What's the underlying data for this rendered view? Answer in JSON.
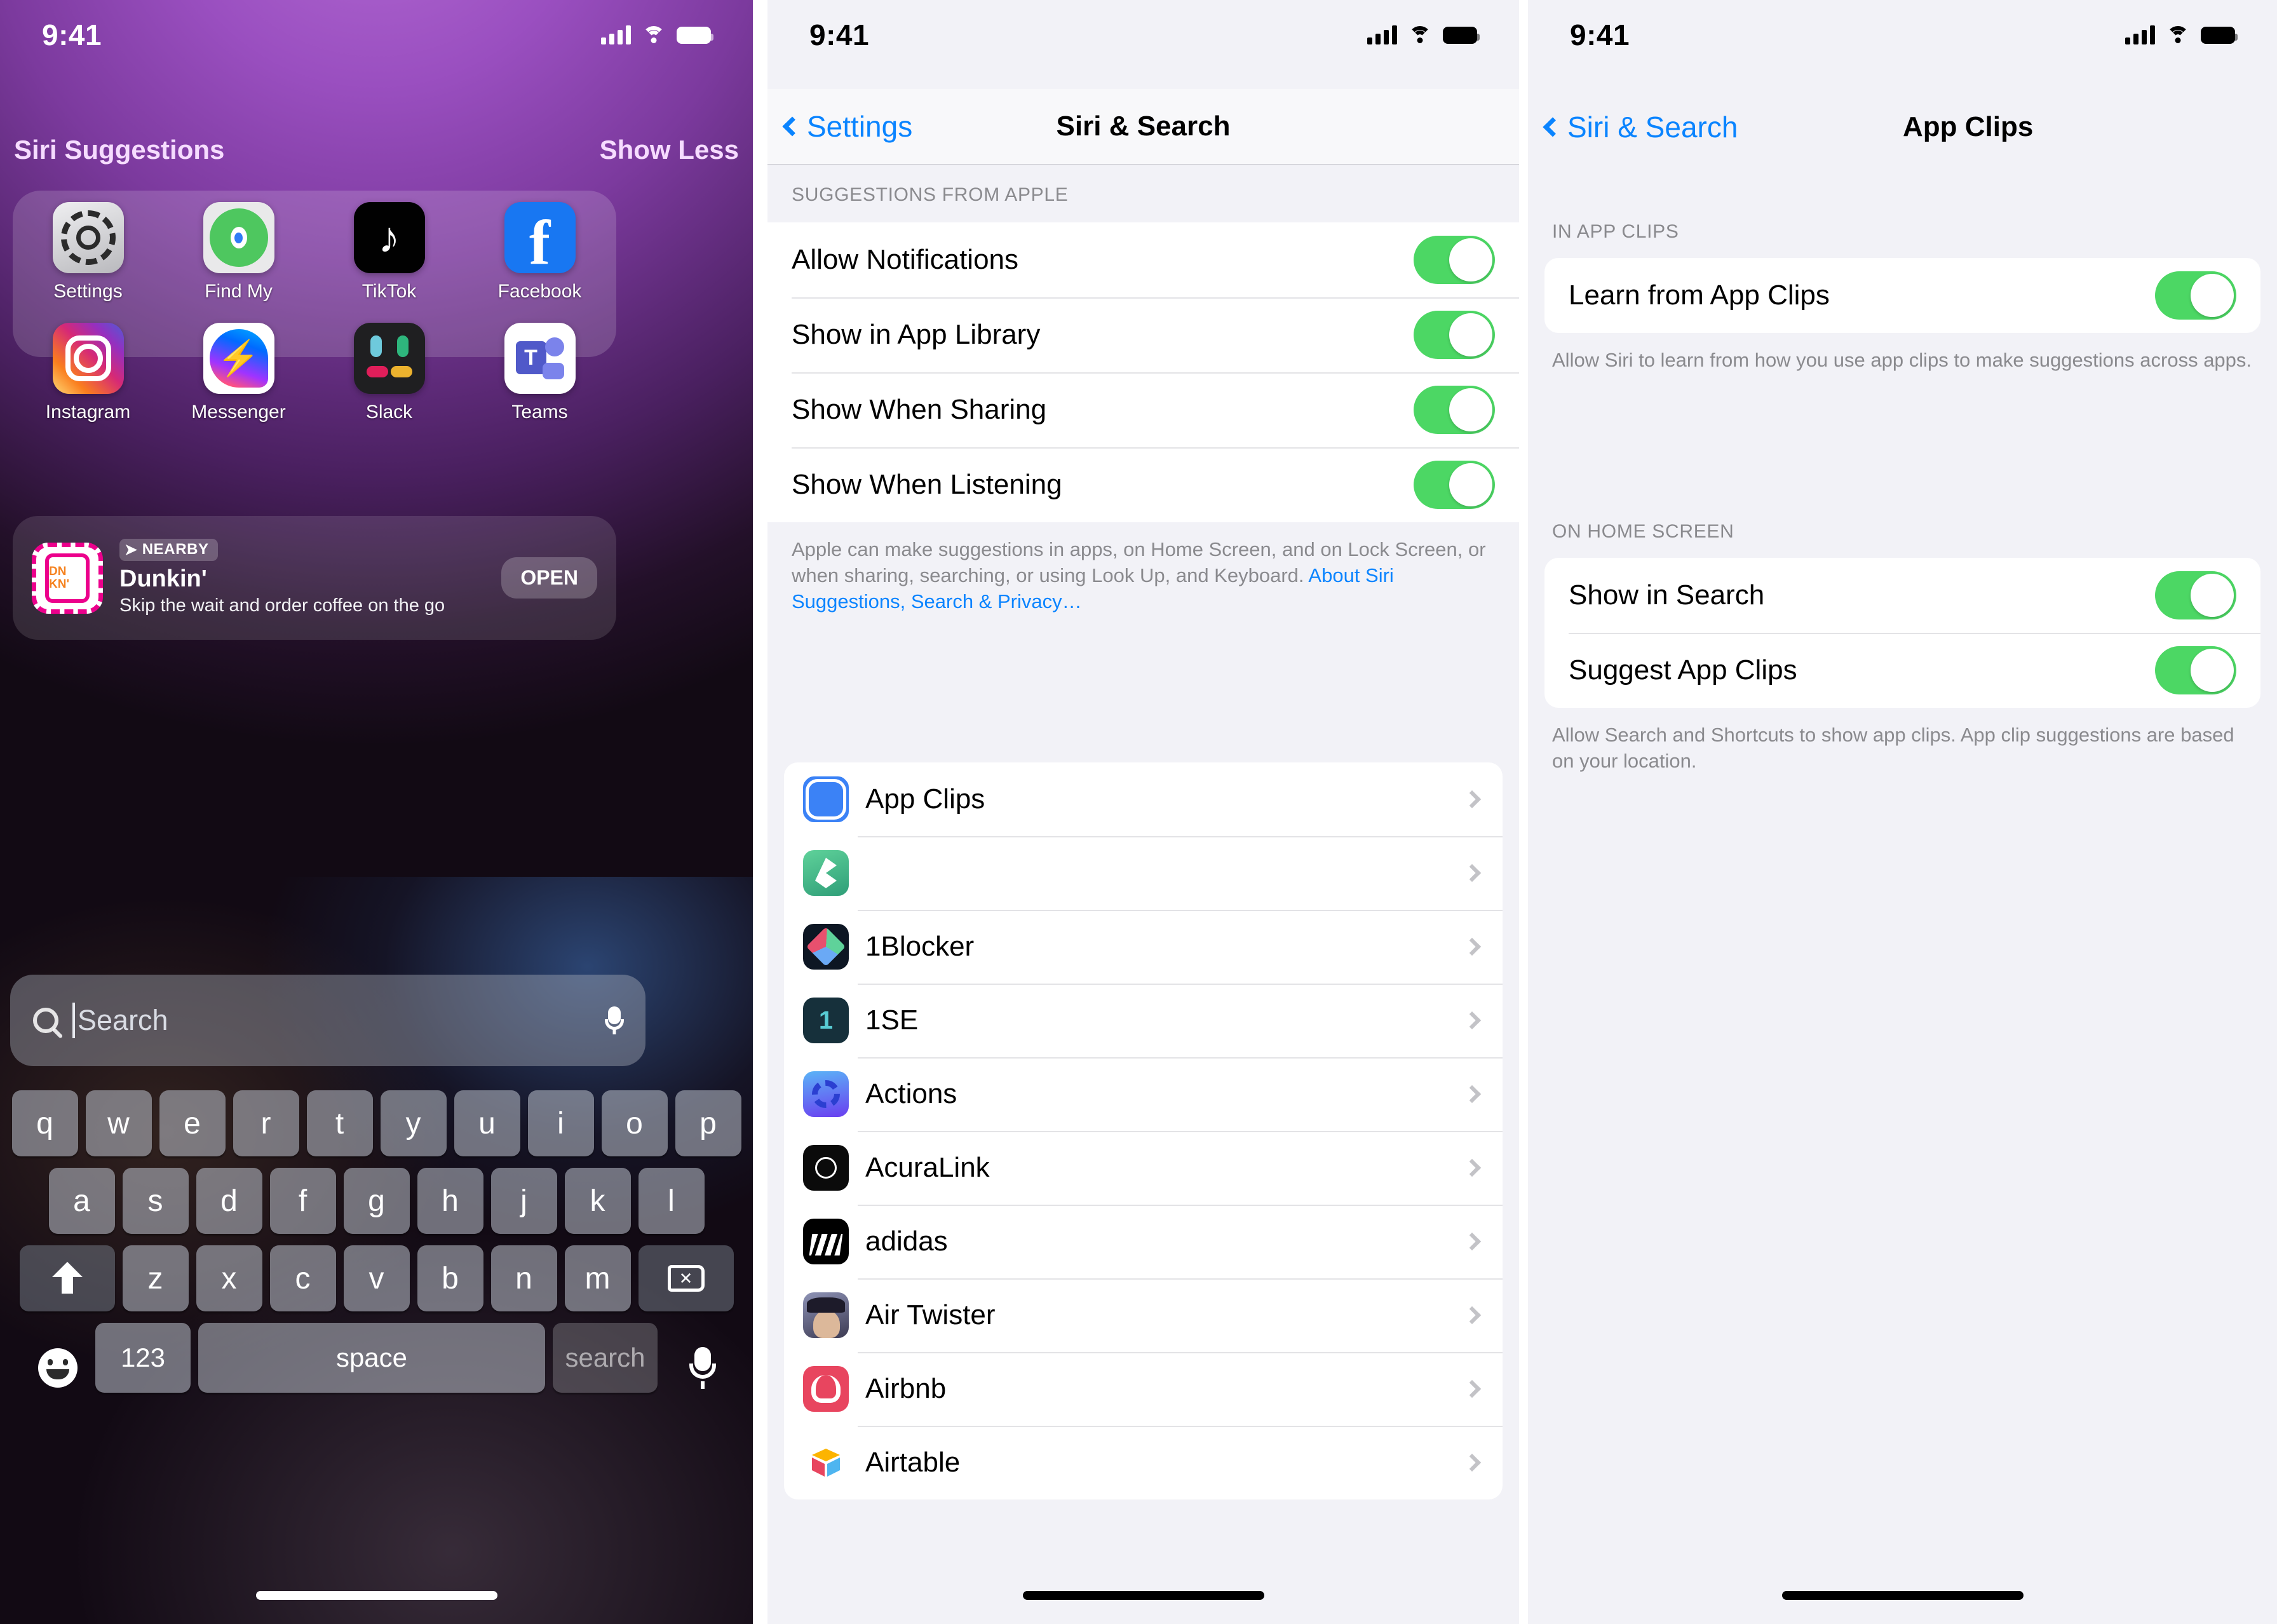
{
  "panel1": {
    "status_bar": {
      "time": "9:41",
      "cellular_icon": "cellular-bars-icon",
      "wifi_icon": "wifi-icon",
      "battery_icon": "battery-icon"
    },
    "header": {
      "title": "Siri Suggestions",
      "action": "Show Less"
    },
    "apps": [
      {
        "label": "Settings",
        "icon": "settings-app-icon"
      },
      {
        "label": "Find My",
        "icon": "find-my-app-icon"
      },
      {
        "label": "TikTok",
        "icon": "tiktok-app-icon"
      },
      {
        "label": "Facebook",
        "icon": "facebook-app-icon"
      },
      {
        "label": "Instagram",
        "icon": "instagram-app-icon"
      },
      {
        "label": "Messenger",
        "icon": "messenger-app-icon"
      },
      {
        "label": "Slack",
        "icon": "slack-app-icon"
      },
      {
        "label": "Teams",
        "icon": "teams-app-icon"
      }
    ],
    "nearby_card": {
      "badge": "NEARBY",
      "badge_icon": "location-arrow-icon",
      "title": "Dunkin'",
      "subtitle": "Skip the wait and order coffee on the go",
      "button": "OPEN",
      "app_icon_text": "DN KN'"
    },
    "search": {
      "placeholder": "Search",
      "value": "",
      "search_icon": "search-icon",
      "mic_icon": "microphone-icon"
    },
    "keyboard": {
      "row1": [
        "q",
        "w",
        "e",
        "r",
        "t",
        "y",
        "u",
        "i",
        "o",
        "p"
      ],
      "row2": [
        "a",
        "s",
        "d",
        "f",
        "g",
        "h",
        "j",
        "k",
        "l"
      ],
      "row3": [
        "z",
        "x",
        "c",
        "v",
        "b",
        "n",
        "m"
      ],
      "shift_icon": "shift-key-icon",
      "delete_icon": "delete-key-icon",
      "numbers_key": "123",
      "space_key": "space",
      "return_key": "search",
      "emoji_icon": "emoji-key-icon",
      "dictation_icon": "dictation-microphone-icon"
    }
  },
  "panel2": {
    "status_bar": {
      "time": "9:41"
    },
    "nav": {
      "back_label": "Settings",
      "title": "Siri & Search",
      "back_icon": "chevron-left-icon"
    },
    "section_header": "SUGGESTIONS FROM APPLE",
    "toggles": [
      {
        "label": "Allow Notifications",
        "on": true
      },
      {
        "label": "Show in App Library",
        "on": true
      },
      {
        "label": "Show When Sharing",
        "on": true
      },
      {
        "label": "Show When Listening",
        "on": true
      }
    ],
    "footnote_text": "Apple can make suggestions in apps, on Home Screen, and on Lock Screen, or when sharing, searching, or using Look Up, and Keyboard. ",
    "footnote_link": "About Siri Suggestions, Search & Privacy…",
    "apps": [
      {
        "name": "App Clips",
        "icon": "app-clips-icon"
      },
      {
        "name": "",
        "icon": "green-diamond-app-icon"
      },
      {
        "name": "1Blocker",
        "icon": "1blocker-app-icon"
      },
      {
        "name": "1SE",
        "icon": "1se-app-icon"
      },
      {
        "name": "Actions",
        "icon": "actions-app-icon"
      },
      {
        "name": "AcuraLink",
        "icon": "acuralink-app-icon"
      },
      {
        "name": "adidas",
        "icon": "adidas-app-icon"
      },
      {
        "name": "Air Twister",
        "icon": "air-twister-app-icon"
      },
      {
        "name": "Airbnb",
        "icon": "airbnb-app-icon"
      },
      {
        "name": "Airtable",
        "icon": "airtable-app-icon"
      }
    ]
  },
  "panel3": {
    "status_bar": {
      "time": "9:41"
    },
    "nav": {
      "back_label": "Siri & Search",
      "title": "App Clips",
      "back_icon": "chevron-left-icon"
    },
    "section1_header": "IN APP CLIPS",
    "section1_toggles": [
      {
        "label": "Learn from App Clips",
        "on": true
      }
    ],
    "section1_footnote": "Allow Siri to learn from how you use app clips to make suggestions across apps.",
    "section2_header": "ON HOME SCREEN",
    "section2_toggles": [
      {
        "label": "Show in Search",
        "on": true
      },
      {
        "label": "Suggest App Clips",
        "on": true
      }
    ],
    "section2_footnote": "Allow Search and Shortcuts to show app clips. App clip suggestions are based on your location."
  },
  "colors": {
    "toggle_on": "#4cd764",
    "ios_blue": "#0a84ff",
    "settings_bg": "#f2f2f7",
    "group_header": "#8a8a8e"
  }
}
